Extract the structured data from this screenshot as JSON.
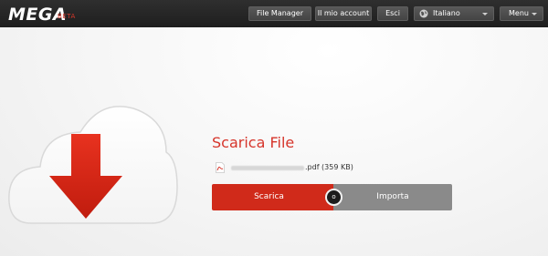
{
  "header": {
    "logo": "MEGA",
    "beta": "BETA",
    "nav": {
      "file_manager": "File Manager",
      "account": "Il mio account",
      "logout": "Esci",
      "language": "Italiano",
      "menu": "Menu"
    }
  },
  "main": {
    "title": "Scarica File",
    "file": {
      "icon": "pdf-icon",
      "extension_and_size": ".pdf (359 KB)"
    },
    "buttons": {
      "download": "Scarica",
      "or": "o",
      "import": "Importa"
    },
    "illustration": "cloud-download-icon"
  },
  "colors": {
    "accent": "#d02a1a",
    "title": "#d6352b",
    "topbar": "#262626",
    "import_button": "#8a8a8a"
  }
}
